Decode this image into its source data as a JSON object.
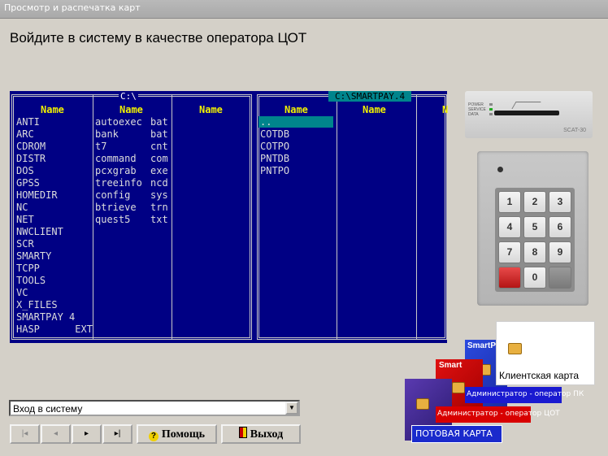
{
  "window": {
    "title": "Просмотр и распечатка карт"
  },
  "heading": "Войдите в систему в качестве оператора ЦОТ",
  "nc": {
    "left_panel": {
      "path": "C:\\",
      "columns": [
        "Name",
        "Name",
        "Name"
      ],
      "col1": [
        "ANTI",
        "ARC",
        "CDROM",
        "DISTR",
        "DOS",
        "GPSS",
        "HOMEDIR",
        "NC",
        "NET",
        "NWCLIENT",
        "SCR",
        "SMARTY",
        "TCPP",
        "TOOLS",
        "VC",
        "X_FILES",
        "SMARTPAY 4",
        "HASP      EXT"
      ],
      "col2_names": [
        "autoexec",
        "bank",
        "t7",
        "command",
        "pcxgrab",
        "treeinfo",
        "config",
        "btrieve",
        "quest5"
      ],
      "col2_ext": [
        "bat",
        "bat",
        "cnt",
        "com",
        "exe",
        "ncd",
        "sys",
        "trn",
        "txt"
      ]
    },
    "right_panel": {
      "path": "C:\\SMARTPAY.4",
      "columns": [
        "Name",
        "Name",
        "N"
      ],
      "col1": [
        "..",
        "COTDB",
        "COTPO",
        "PNTDB",
        "PNTPO"
      ]
    }
  },
  "devices": {
    "reader_label": "POWER\nSERVICE\nDATA",
    "reader_model": "SCAT-30",
    "keypad": [
      "1",
      "2",
      "3",
      "4",
      "5",
      "6",
      "7",
      "8",
      "9",
      "",
      "0",
      ""
    ]
  },
  "cards": {
    "client": "Клиентская карта",
    "admin_pk": "Администратор - оператор  ПК",
    "admin_cot": "Администратор - оператор ЦОТ",
    "postal": "ПОТОВАЯ КАРТА",
    "smart": "SmartP",
    "smart2": "Smart"
  },
  "combo": {
    "value": "Вход в систему"
  },
  "buttons": {
    "first": "|◂",
    "prev": "◂",
    "next": "▸",
    "last": "▸|",
    "help": "Помощь",
    "exit": "Выход"
  },
  "colors": {
    "nc_bg": "#000084",
    "nc_header": "#f0f000",
    "nc_cursor": "#00848c"
  }
}
